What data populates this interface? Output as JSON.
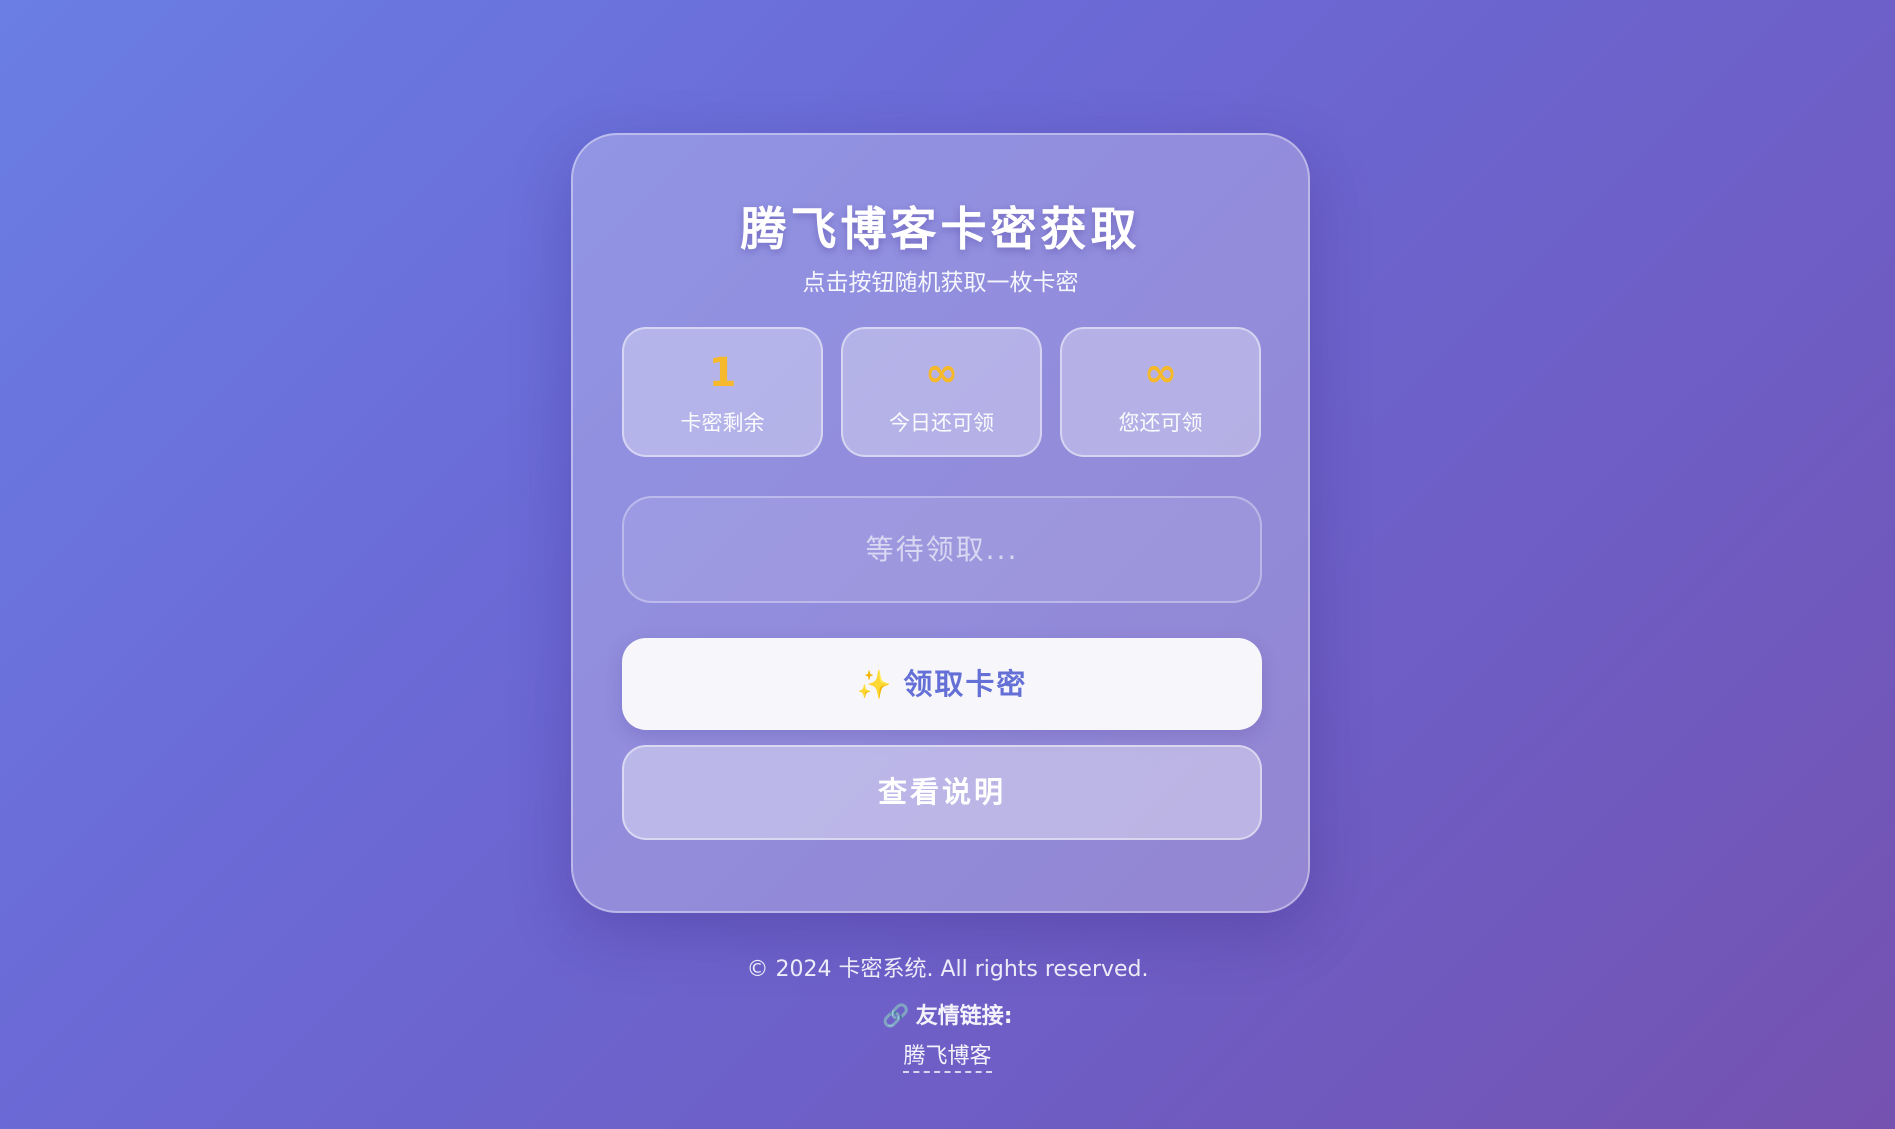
{
  "card": {
    "title": "腾飞博客卡密获取",
    "subtitle": "点击按钮随机获取一枚卡密"
  },
  "stats": [
    {
      "value": "1",
      "label": "卡密剩余"
    },
    {
      "value": "∞",
      "label": "今日还可领"
    },
    {
      "value": "∞",
      "label": "您还可领"
    }
  ],
  "result": {
    "placeholder": "等待领取..."
  },
  "buttons": {
    "claim_icon": "sparkles-icon",
    "claim_glyph": "✨",
    "claim_label": "领取卡密",
    "help_label": "查看说明"
  },
  "footer": {
    "copyright": "© 2024 卡密系统. All rights reserved.",
    "links_icon": "link-icon",
    "links_glyph": "🔗",
    "links_heading": "友情链接:",
    "links": [
      {
        "label": "腾飞博客"
      }
    ]
  },
  "colors": {
    "accent_yellow": "#f6b92b",
    "button_text": "#6470d6",
    "gradient_start": "#6a7ee3",
    "gradient_end": "#7552b0"
  }
}
